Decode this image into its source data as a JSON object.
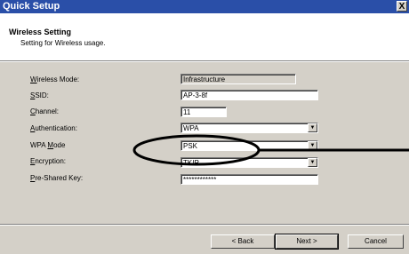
{
  "window": {
    "title": "Quick Setup",
    "close": "X"
  },
  "header": {
    "title": "Wireless Setting",
    "subtitle": "Setting for Wireless usage."
  },
  "fields": {
    "mode": {
      "label_pre": "",
      "label_key": "W",
      "label_post": "ireless Mode:",
      "value": "Infrastructure"
    },
    "ssid": {
      "label_pre": "",
      "label_key": "S",
      "label_post": "SID:",
      "value": "AP-3-8f"
    },
    "channel": {
      "label_pre": "",
      "label_key": "C",
      "label_post": "hannel:",
      "value": "11"
    },
    "auth": {
      "label_pre": "",
      "label_key": "A",
      "label_post": "uthentication:",
      "value": "WPA"
    },
    "wpa": {
      "label_pre": "WPA ",
      "label_key": "M",
      "label_post": "ode",
      "value": "PSK"
    },
    "enc": {
      "label_pre": "",
      "label_key": "E",
      "label_post": "ncryption:",
      "value": "TKIP"
    },
    "psk": {
      "label_pre": "",
      "label_key": "P",
      "label_post": "re-Shared Key:",
      "value": "************"
    }
  },
  "buttons": {
    "back": "< Back",
    "next": "Next >",
    "cancel": "Cancel"
  },
  "icons": {
    "dropdown": "▼"
  }
}
